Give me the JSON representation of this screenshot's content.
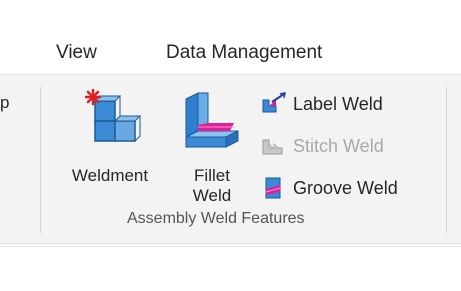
{
  "menu": {
    "items": [
      {
        "label": "View"
      },
      {
        "label": "Data Management"
      }
    ]
  },
  "ribbon": {
    "prev_group_label_fragment": "p",
    "buttons": {
      "weldment": {
        "label": "Weldment",
        "icon": "weldment-icon"
      },
      "fillet_weld": {
        "label_line1": "Fillet",
        "label_line2": "Weld",
        "icon": "fillet-weld-icon"
      },
      "label_weld": {
        "label": "Label Weld",
        "icon": "label-weld-icon"
      },
      "stitch_weld": {
        "label": "Stitch Weld",
        "icon": "stitch-weld-icon",
        "disabled": true
      },
      "groove_weld": {
        "label": "Groove Weld",
        "icon": "groove-weld-icon"
      }
    },
    "group_label": "Assembly Weld Features"
  },
  "colors": {
    "ribbon_bg": "#f3f3f3",
    "accent_blue": "#1f7fd0",
    "accent_pink": "#e0209a",
    "accent_red": "#e02020",
    "disabled_text": "#a9a9a9"
  }
}
